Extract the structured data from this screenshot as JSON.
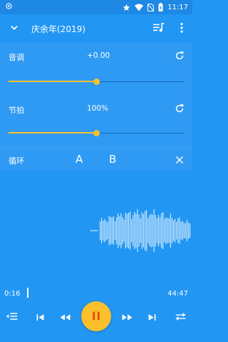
{
  "status_bar": {
    "time": "11:17",
    "icons": [
      "app-notification-icon",
      "star-icon",
      "wifi-icon",
      "no-sim-icon",
      "battery-charging-icon"
    ]
  },
  "toolbar": {
    "title": "庆余年(2019)",
    "icons": [
      "chevron-down-icon",
      "playlist-icon",
      "more-vert-icon"
    ]
  },
  "pitch": {
    "label": "音调",
    "value": "+0.00",
    "level": 0.5
  },
  "tempo": {
    "label": "节拍",
    "value": "100%",
    "level": 0.5
  },
  "loop": {
    "label": "循环",
    "point_a": "A",
    "point_b": "B"
  },
  "playback": {
    "current_time": "0:16",
    "total_time": "44:47"
  },
  "colors": {
    "background": "#2196F3",
    "status_bar": "#1E88E5",
    "accent": "#FBC02D",
    "track": "#1565C0"
  }
}
